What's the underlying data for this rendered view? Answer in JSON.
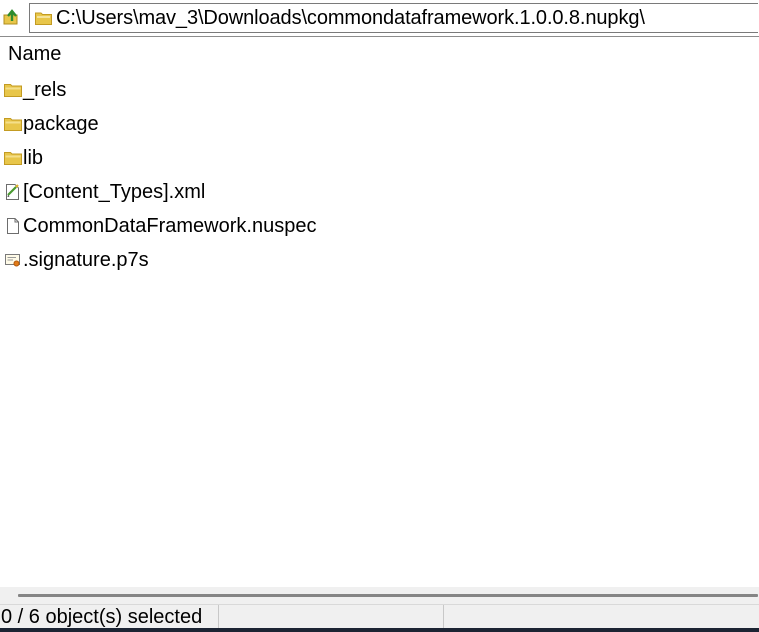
{
  "path_bar": {
    "up_button_icon": "folder-up-icon",
    "path_icon": "folder-icon",
    "path": "C:\\Users\\mav_3\\Downloads\\commondataframework.1.0.0.8.nupkg\\"
  },
  "file_list": {
    "columns": [
      "Name"
    ],
    "items": [
      {
        "name": "_rels",
        "icon": "folder-icon"
      },
      {
        "name": "package",
        "icon": "folder-icon"
      },
      {
        "name": "lib",
        "icon": "folder-icon"
      },
      {
        "name": "[Content_Types].xml",
        "icon": "xml-file-icon"
      },
      {
        "name": "CommonDataFramework.nuspec",
        "icon": "file-icon"
      },
      {
        "name": ".signature.p7s",
        "icon": "certificate-file-icon"
      }
    ]
  },
  "status_bar": {
    "selection": "0 / 6 object(s) selected"
  },
  "colors": {
    "folder": "#e8c64a",
    "background": "#ffffff",
    "status_bg": "#f0f0f0"
  }
}
